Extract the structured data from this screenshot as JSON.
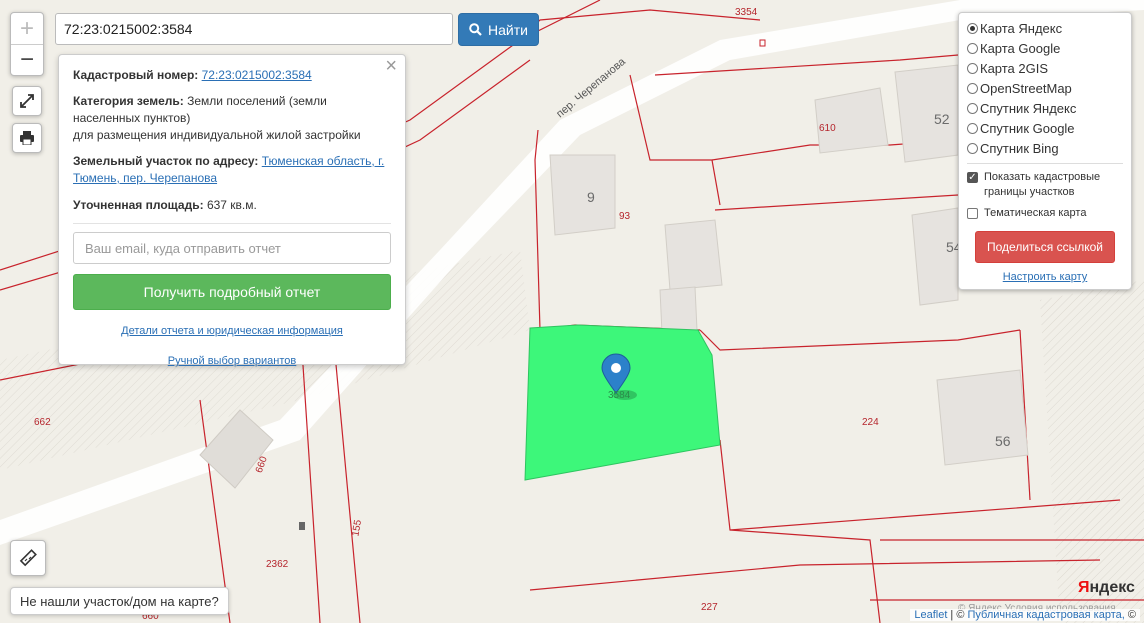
{
  "search": {
    "value": "72:23:0215002:3584",
    "find_label": "Найти"
  },
  "zoom": {
    "in": "+",
    "out": "−"
  },
  "popup": {
    "close": "×",
    "cad_label": "Кадастровый номер:",
    "cad_value": "72:23:0215002:3584",
    "cat_label": "Категория земель:",
    "cat_value": "Земли поселений (земли населенных пунктов)",
    "cat_purpose": "для размещения индивидуальной жилой застройки",
    "addr_label": "Земельный участок по адресу:",
    "addr_value": "Тюменская область, г. Тюмень, пер. Черепанова",
    "area_label": "Уточненная площадь:",
    "area_value": "637 кв.м.",
    "email_placeholder": "Ваш email, куда отправить отчет",
    "report_button": "Получить подробный отчет",
    "details_link": "Детали отчета и юридическая информация",
    "manual_link": "Ручной выбор вариантов"
  },
  "layers": {
    "options": [
      "Карта Яндекс",
      "Карта Google",
      "Карта 2GIS",
      "OpenStreetMap",
      "Спутник Яндекс",
      "Спутник Google",
      "Спутник Bing"
    ],
    "selected": "Карта Яндекс",
    "show_borders": "Показать кадастровые границы участков",
    "show_borders_checked": true,
    "thematic": "Тематическая карта",
    "thematic_checked": false,
    "share_button": "Поделиться ссылкой",
    "configure_link": "Настроить карту"
  },
  "map_labels": {
    "street": "пер. Черепанова",
    "parcel_3354": "3354",
    "parcel_610": "610",
    "house_52": "52",
    "house_9": "9",
    "parcel_93": "93",
    "house_54": "54",
    "parcel_3584": "3584",
    "parcel_662": "662",
    "parcel_660a": "660",
    "parcel_224": "224",
    "house_56": "56",
    "parcel_155": "155",
    "parcel_2362": "2362",
    "parcel_227": "227",
    "parcel_660b": "660"
  },
  "bottom": {
    "hint": "Не нашли участок/дом на карте?",
    "leaflet": "Leaflet",
    "attribution": "Публичная кадастровая карта,",
    "yandex_logo_red": "Я",
    "yandex_logo_rest": "ндекс",
    "yandex_copy": "© Яндекс Условия использования"
  },
  "colors": {
    "parcel_line": "#c8232c",
    "selected_parcel": "#3df77a",
    "building": "#e6e3df"
  }
}
